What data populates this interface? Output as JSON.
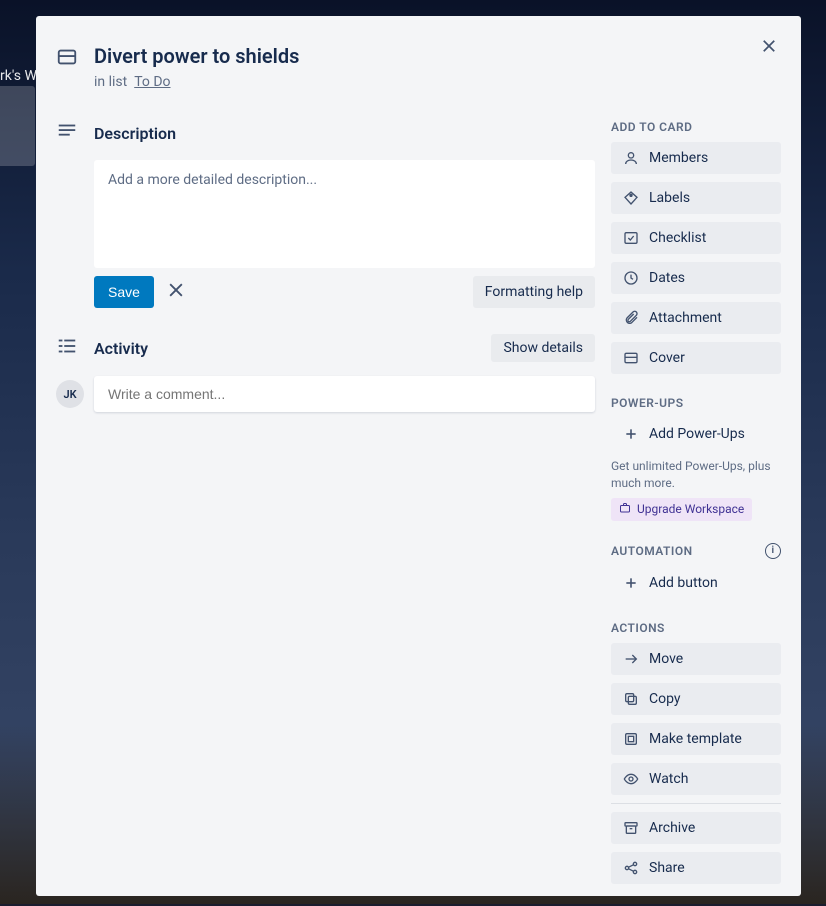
{
  "background": {
    "workspace_partial": "rk's  W"
  },
  "card": {
    "title": "Divert power to shields",
    "list_prefix": "in list",
    "list_name": "To Do"
  },
  "description": {
    "heading": "Description",
    "placeholder": "Add a more detailed description...",
    "save_label": "Save",
    "formatting_help": "Formatting help"
  },
  "activity": {
    "heading": "Activity",
    "show_details": "Show details",
    "avatar_initials": "JK",
    "comment_placeholder": "Write a comment..."
  },
  "sidebar": {
    "add_to_card": {
      "heading": "ADD TO CARD",
      "items": [
        {
          "label": "Members"
        },
        {
          "label": "Labels"
        },
        {
          "label": "Checklist"
        },
        {
          "label": "Dates"
        },
        {
          "label": "Attachment"
        },
        {
          "label": "Cover"
        }
      ]
    },
    "powerups": {
      "heading": "POWER-UPS",
      "add_label": "Add Power-Ups",
      "note": "Get unlimited Power-Ups, plus much more.",
      "upgrade_label": "Upgrade Workspace"
    },
    "automation": {
      "heading": "AUTOMATION",
      "add_label": "Add button"
    },
    "actions": {
      "heading": "ACTIONS",
      "items": [
        {
          "label": "Move"
        },
        {
          "label": "Copy"
        },
        {
          "label": "Make template"
        },
        {
          "label": "Watch"
        }
      ],
      "items2": [
        {
          "label": "Archive"
        },
        {
          "label": "Share"
        }
      ]
    }
  }
}
